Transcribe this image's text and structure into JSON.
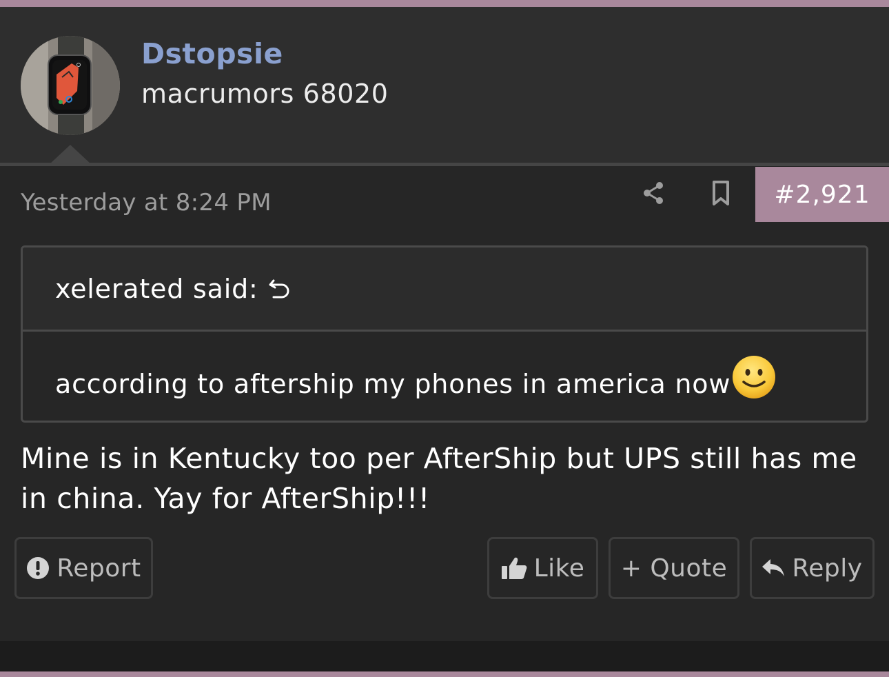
{
  "colors": {
    "accent": "#a9889c",
    "username": "#8aa0cf",
    "background": "#262626",
    "header_background": "#2e2e2e"
  },
  "user": {
    "name": "Dstopsie",
    "title": "macrumors 68020",
    "avatar": "apple-watch-photo"
  },
  "post": {
    "timestamp": "Yesterday at 8:24 PM",
    "number": "#2,921",
    "icons": [
      "share-icon",
      "bookmark-icon"
    ],
    "quote": {
      "author_label": "xelerated said:",
      "text": "according to aftership my phones in america now",
      "emoji": "slightly-smiling-face"
    },
    "message": "Mine is in Kentucky too per AfterShip but UPS still has me in china. Yay for AfterShip!!!"
  },
  "actions": {
    "report_label": "Report",
    "like_label": "Like",
    "quote_label": "+ Quote",
    "reply_label": "Reply"
  }
}
